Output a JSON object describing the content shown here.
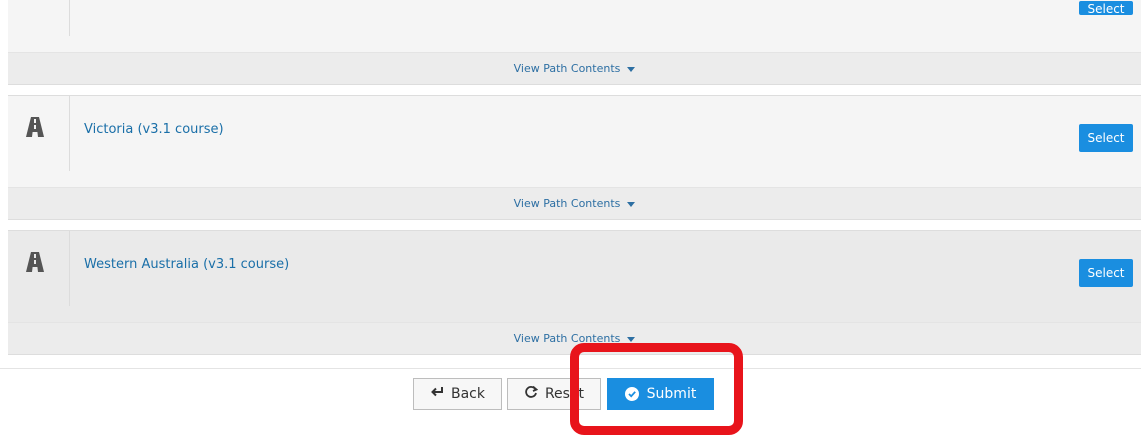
{
  "paths": [
    {
      "title": "",
      "select_label": "Select",
      "view_contents_label": "View Path Contents"
    },
    {
      "title": "Victoria (v3.1 course)",
      "select_label": "Select",
      "view_contents_label": "View Path Contents"
    },
    {
      "title": "Western Australia (v3.1 course)",
      "select_label": "Select",
      "view_contents_label": "View Path Contents"
    }
  ],
  "actions": {
    "back_label": "Back",
    "reset_label": "Reset",
    "submit_label": "Submit"
  },
  "icons": {
    "path": "road-icon",
    "back": "arrow-return-left-icon",
    "reset": "refresh-icon",
    "submit": "check-circle-icon"
  },
  "colors": {
    "primary": "#1a8ee0",
    "link": "#1a6fa8",
    "annotation": "#e8141b"
  }
}
